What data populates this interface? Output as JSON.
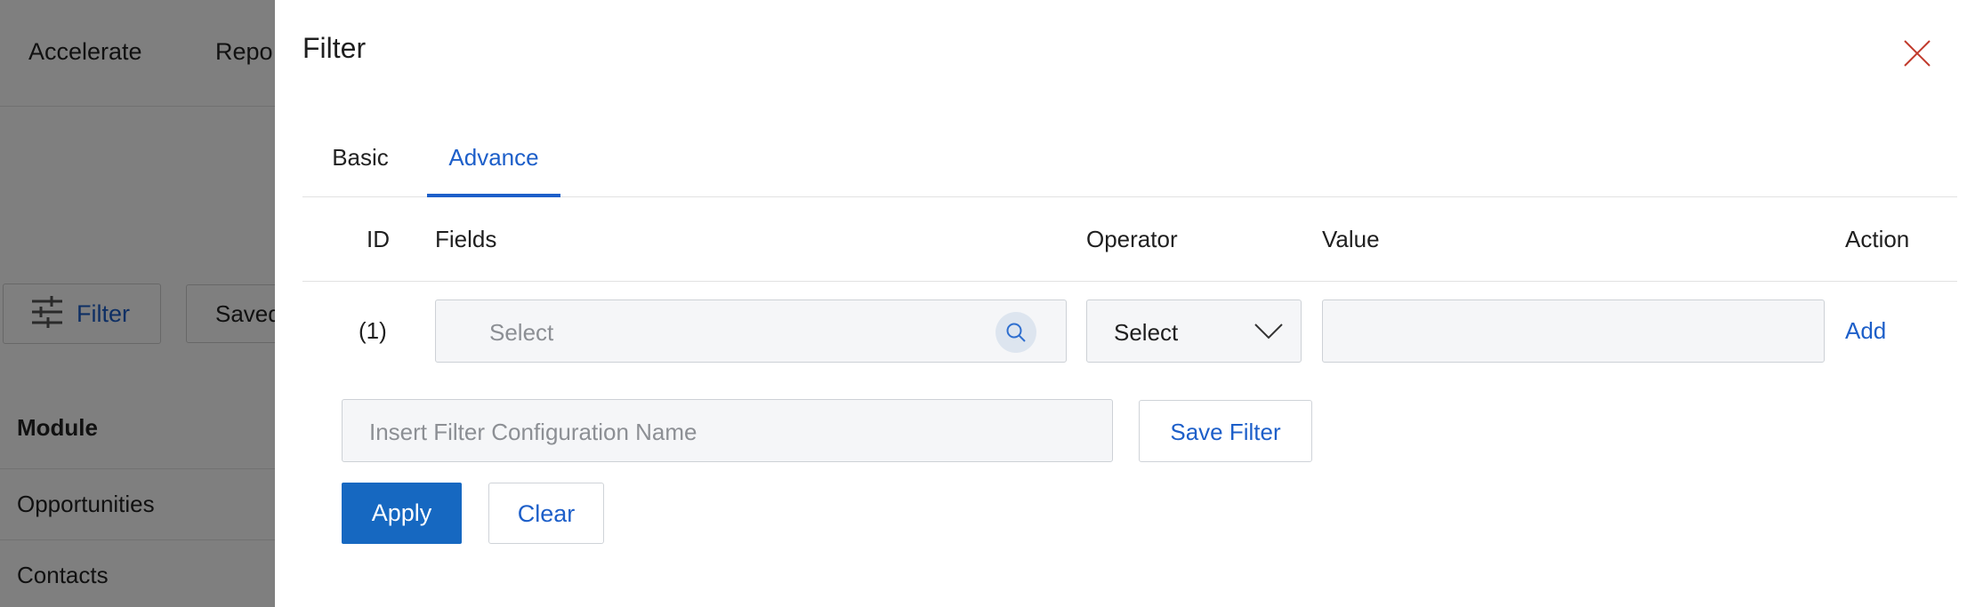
{
  "background": {
    "nav_items": [
      "Accelerate",
      "Repo"
    ],
    "filter_button_label": "Filter",
    "saved_button_label": "Saved",
    "module_header": "Module",
    "module_items": [
      "Opportunities",
      "Contacts"
    ]
  },
  "drawer": {
    "title": "Filter",
    "tabs": [
      {
        "label": "Basic",
        "active": false
      },
      {
        "label": "Advance",
        "active": true
      }
    ],
    "columns": {
      "id": "ID",
      "fields": "Fields",
      "operator": "Operator",
      "value": "Value",
      "action": "Action"
    },
    "rows": [
      {
        "id": "(1)",
        "field_placeholder": "Select",
        "operator_value": "Select",
        "value": "",
        "action_label": "Add"
      }
    ],
    "config_name_placeholder": "Insert Filter Configuration Name",
    "save_filter_label": "Save Filter",
    "apply_label": "Apply",
    "clear_label": "Clear"
  },
  "colors": {
    "accent": "#1d5fc9",
    "primary_button": "#1668c1",
    "close_icon": "#c0392b",
    "overlay": "rgba(0,0,0,0.5)"
  },
  "icons": {
    "close": "close-icon",
    "search": "search-icon",
    "dropdown": "chevron-down-icon",
    "filter": "sliders-icon"
  }
}
